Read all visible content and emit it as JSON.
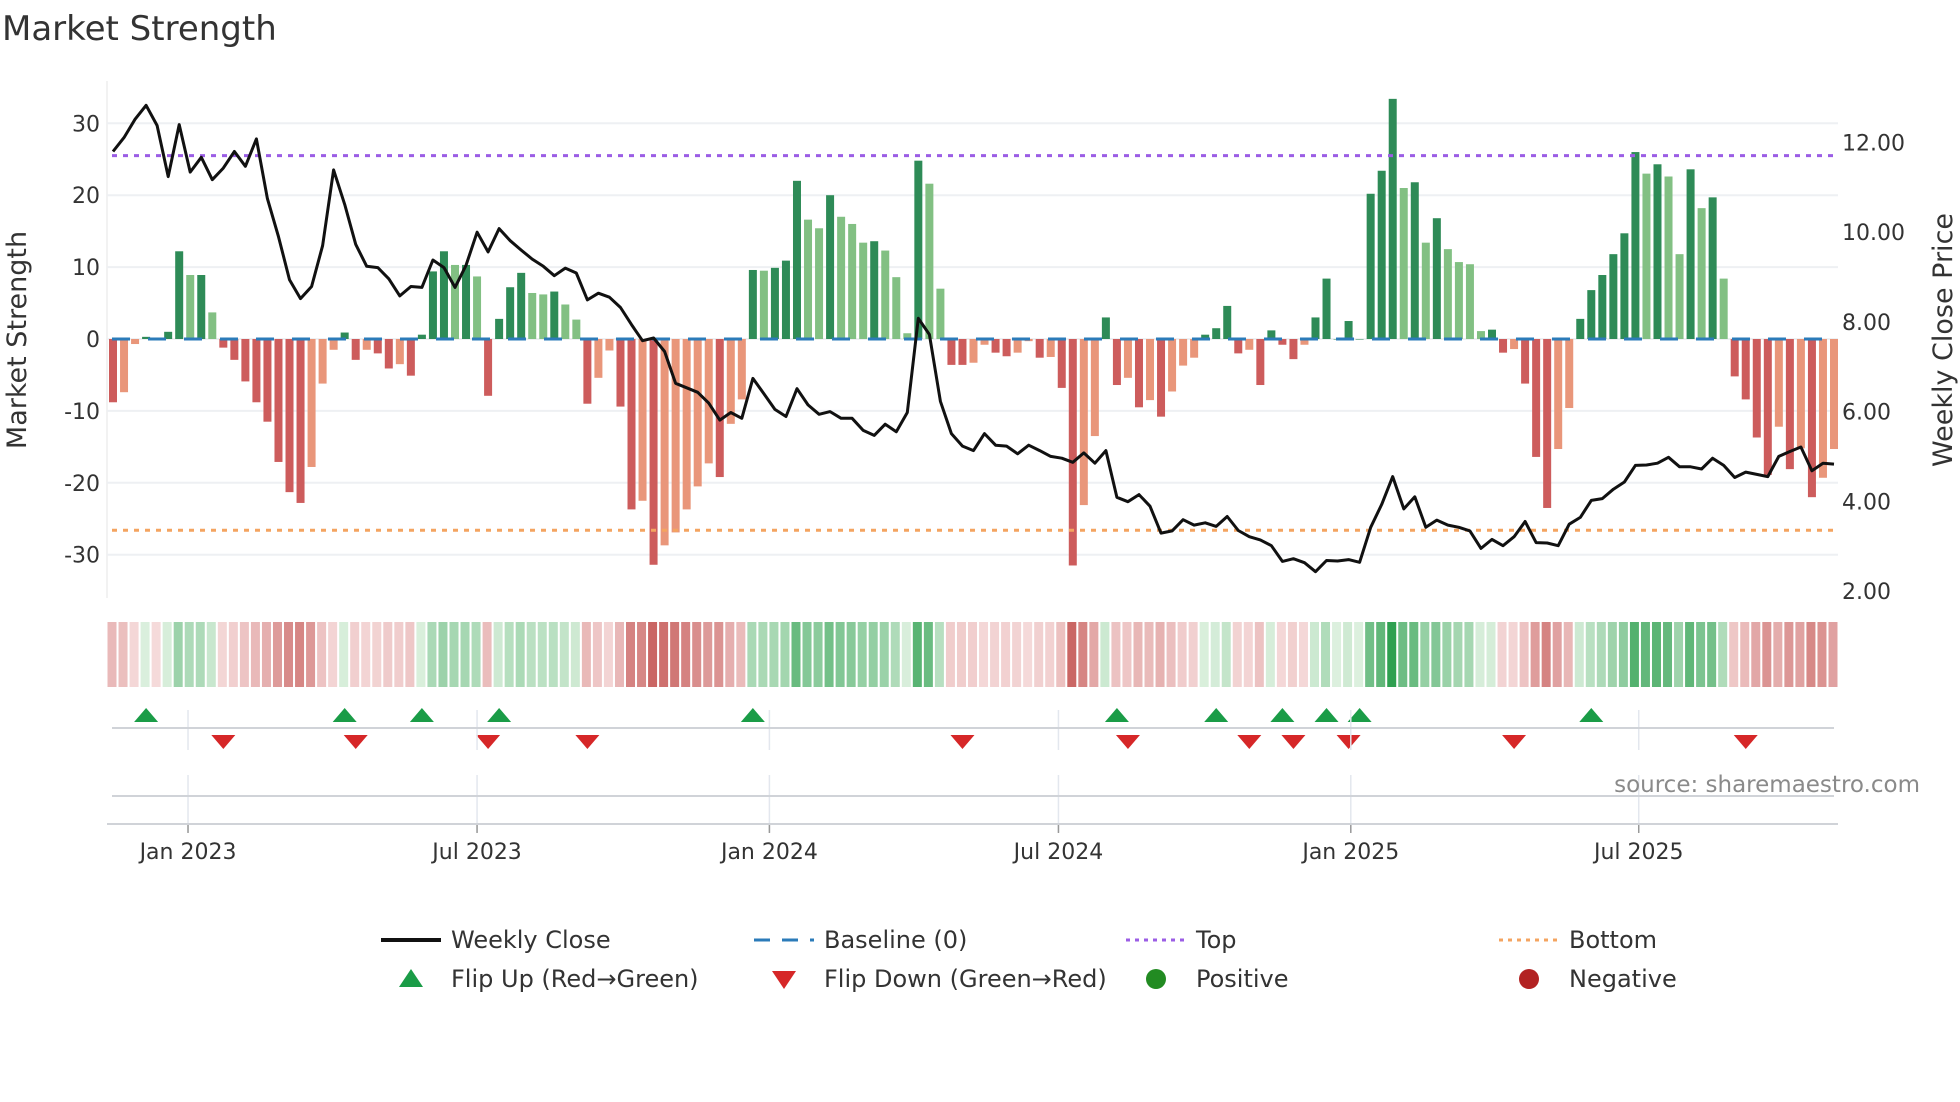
{
  "chart_data": {
    "type": "bar",
    "title": "Market Strength",
    "ylabel": "Market Strength",
    "y2label": "Weekly Close Price",
    "ylim": [
      -36,
      36
    ],
    "y2lim": [
      2.0,
      13.3
    ],
    "yticks": [
      -30,
      -20,
      -10,
      0,
      10,
      20,
      30
    ],
    "y2ticks": [
      "2.00",
      "4.00",
      "6.00",
      "8.00",
      "10.00",
      "12.00"
    ],
    "xticks": [
      {
        "label": "Jan 2023",
        "week": 6.8
      },
      {
        "label": "Jul 2023",
        "week": 33.0
      },
      {
        "label": "Jan 2024",
        "week": 59.5
      },
      {
        "label": "Jul 2024",
        "week": 85.7
      },
      {
        "label": "Jan 2025",
        "week": 112.2
      },
      {
        "label": "Jul 2025",
        "week": 138.3
      }
    ],
    "top_level": 25.5,
    "bottom_level": -26.6,
    "baseline": 0,
    "strength": [
      -8.8,
      -7.4,
      -0.7,
      0.3,
      -0.1,
      1.0,
      12.2,
      8.9,
      8.9,
      3.7,
      -1.2,
      -2.9,
      -5.9,
      -8.8,
      -11.5,
      -17.1,
      -21.3,
      -22.8,
      -17.8,
      -6.2,
      -1.5,
      0.9,
      -2.9,
      -1.5,
      -2.0,
      -4.1,
      -3.5,
      -5.1,
      0.6,
      9.4,
      12.2,
      10.3,
      10.3,
      8.7,
      -7.9,
      2.8,
      7.2,
      9.2,
      6.4,
      6.2,
      6.6,
      4.8,
      2.7,
      -9.0,
      -5.4,
      -1.6,
      -9.4,
      -23.7,
      -22.5,
      -31.4,
      -28.7,
      -26.9,
      -23.7,
      -20.5,
      -17.3,
      -19.2,
      -11.8,
      -8.4,
      9.6,
      9.5,
      9.9,
      10.9,
      22.0,
      16.6,
      15.4,
      20.0,
      17.0,
      16.0,
      13.4,
      13.6,
      12.3,
      8.6,
      0.8,
      24.8,
      21.6,
      7.0,
      -3.6,
      -3.6,
      -3.3,
      -0.8,
      -1.9,
      -2.4,
      -1.9,
      -0.3,
      -2.6,
      -2.5,
      -6.8,
      -31.5,
      -23.1,
      -13.5,
      3.0,
      -6.4,
      -5.4,
      -9.5,
      -8.5,
      -10.8,
      -7.3,
      -3.7,
      -2.6,
      0.6,
      1.5,
      4.6,
      -2.0,
      -1.5,
      -6.4,
      1.2,
      -0.8,
      -2.8,
      -0.8,
      3.0,
      8.4,
      0.0,
      2.5,
      0.0,
      20.2,
      23.4,
      33.4,
      21.0,
      21.8,
      13.4,
      16.8,
      12.5,
      10.7,
      10.4,
      1.1,
      1.3,
      -1.9,
      -1.4,
      -6.2,
      -16.4,
      -23.5,
      -15.3,
      -9.6,
      2.8,
      6.8,
      8.9,
      11.8,
      14.7,
      26.0,
      23.0,
      24.3,
      22.6,
      11.8,
      23.6,
      18.2,
      19.7,
      8.4,
      -5.2,
      -8.4,
      -13.7,
      -18.9,
      -12.2,
      -18.1,
      -15.2,
      -22.0,
      -19.3,
      -15.3
    ],
    "weekly_close": [
      11.8,
      12.11,
      12.52,
      12.83,
      12.38,
      11.24,
      12.4,
      11.34,
      11.67,
      11.17,
      11.43,
      11.8,
      11.47,
      12.08,
      10.75,
      9.9,
      8.94,
      8.52,
      8.79,
      9.7,
      11.39,
      10.62,
      9.73,
      9.24,
      9.21,
      8.96,
      8.58,
      8.79,
      8.77,
      9.38,
      9.21,
      8.77,
      9.26,
      10.0,
      9.56,
      10.08,
      9.81,
      9.6,
      9.4,
      9.24,
      9.03,
      9.2,
      9.09,
      8.49,
      8.64,
      8.55,
      8.32,
      7.94,
      7.58,
      7.64,
      7.34,
      6.63,
      6.53,
      6.43,
      6.19,
      5.81,
      5.98,
      5.85,
      6.74,
      6.4,
      6.05,
      5.89,
      6.51,
      6.15,
      5.94,
      6.0,
      5.85,
      5.85,
      5.58,
      5.47,
      5.72,
      5.55,
      5.98,
      8.08,
      7.72,
      6.23,
      5.51,
      5.23,
      5.13,
      5.51,
      5.25,
      5.23,
      5.06,
      5.25,
      5.13,
      5.0,
      4.96,
      4.87,
      5.08,
      4.85,
      5.13,
      4.09,
      3.99,
      4.15,
      3.89,
      3.29,
      3.34,
      3.59,
      3.47,
      3.52,
      3.44,
      3.66,
      3.35,
      3.21,
      3.14,
      3.01,
      2.66,
      2.72,
      2.63,
      2.43,
      2.68,
      2.67,
      2.7,
      2.64,
      3.42,
      3.93,
      4.55,
      3.83,
      4.1,
      3.42,
      3.58,
      3.47,
      3.42,
      3.34,
      2.95,
      3.15,
      3.01,
      3.21,
      3.55,
      3.08,
      3.07,
      3.01,
      3.49,
      3.64,
      4.02,
      4.06,
      4.27,
      4.43,
      4.8,
      4.81,
      4.85,
      4.98,
      4.77,
      4.77,
      4.72,
      4.96,
      4.8,
      4.53,
      4.65,
      4.6,
      4.55,
      5.0,
      5.11,
      5.21,
      4.68,
      4.85,
      4.83
    ],
    "flip_up_weeks": [
      3,
      21,
      28,
      35,
      58,
      91,
      100,
      106,
      110,
      113,
      134
    ],
    "flip_down_weeks": [
      10,
      22,
      34,
      43,
      77,
      92,
      103,
      107,
      112,
      127,
      148
    ],
    "legend": {
      "placement": "bottom",
      "items": [
        {
          "label": "Weekly Close",
          "symbol": "line",
          "color": "#111111"
        },
        {
          "label": "Baseline (0)",
          "symbol": "dash",
          "color": "#2b7bb9"
        },
        {
          "label": "Top",
          "symbol": "dot",
          "color": "#9b5de5"
        },
        {
          "label": "Bottom",
          "symbol": "dot",
          "color": "#f4a460"
        },
        {
          "label": "Flip Up (Red→Green)",
          "symbol": "triangle-up",
          "color": "#1a9c47"
        },
        {
          "label": "Flip Down (Green→Red)",
          "symbol": "triangle-down",
          "color": "#d62728"
        },
        {
          "label": "Positive",
          "symbol": "circle",
          "color": "#228b22"
        },
        {
          "label": "Negative",
          "symbol": "circle",
          "color": "#b22222"
        }
      ]
    },
    "colors": {
      "pos_strong": "#2e8b57",
      "pos_weak": "#82c083",
      "neg_strong": "#cd5c5c",
      "neg_weak": "#e9967a"
    },
    "source": "source: sharemaestro.com"
  }
}
